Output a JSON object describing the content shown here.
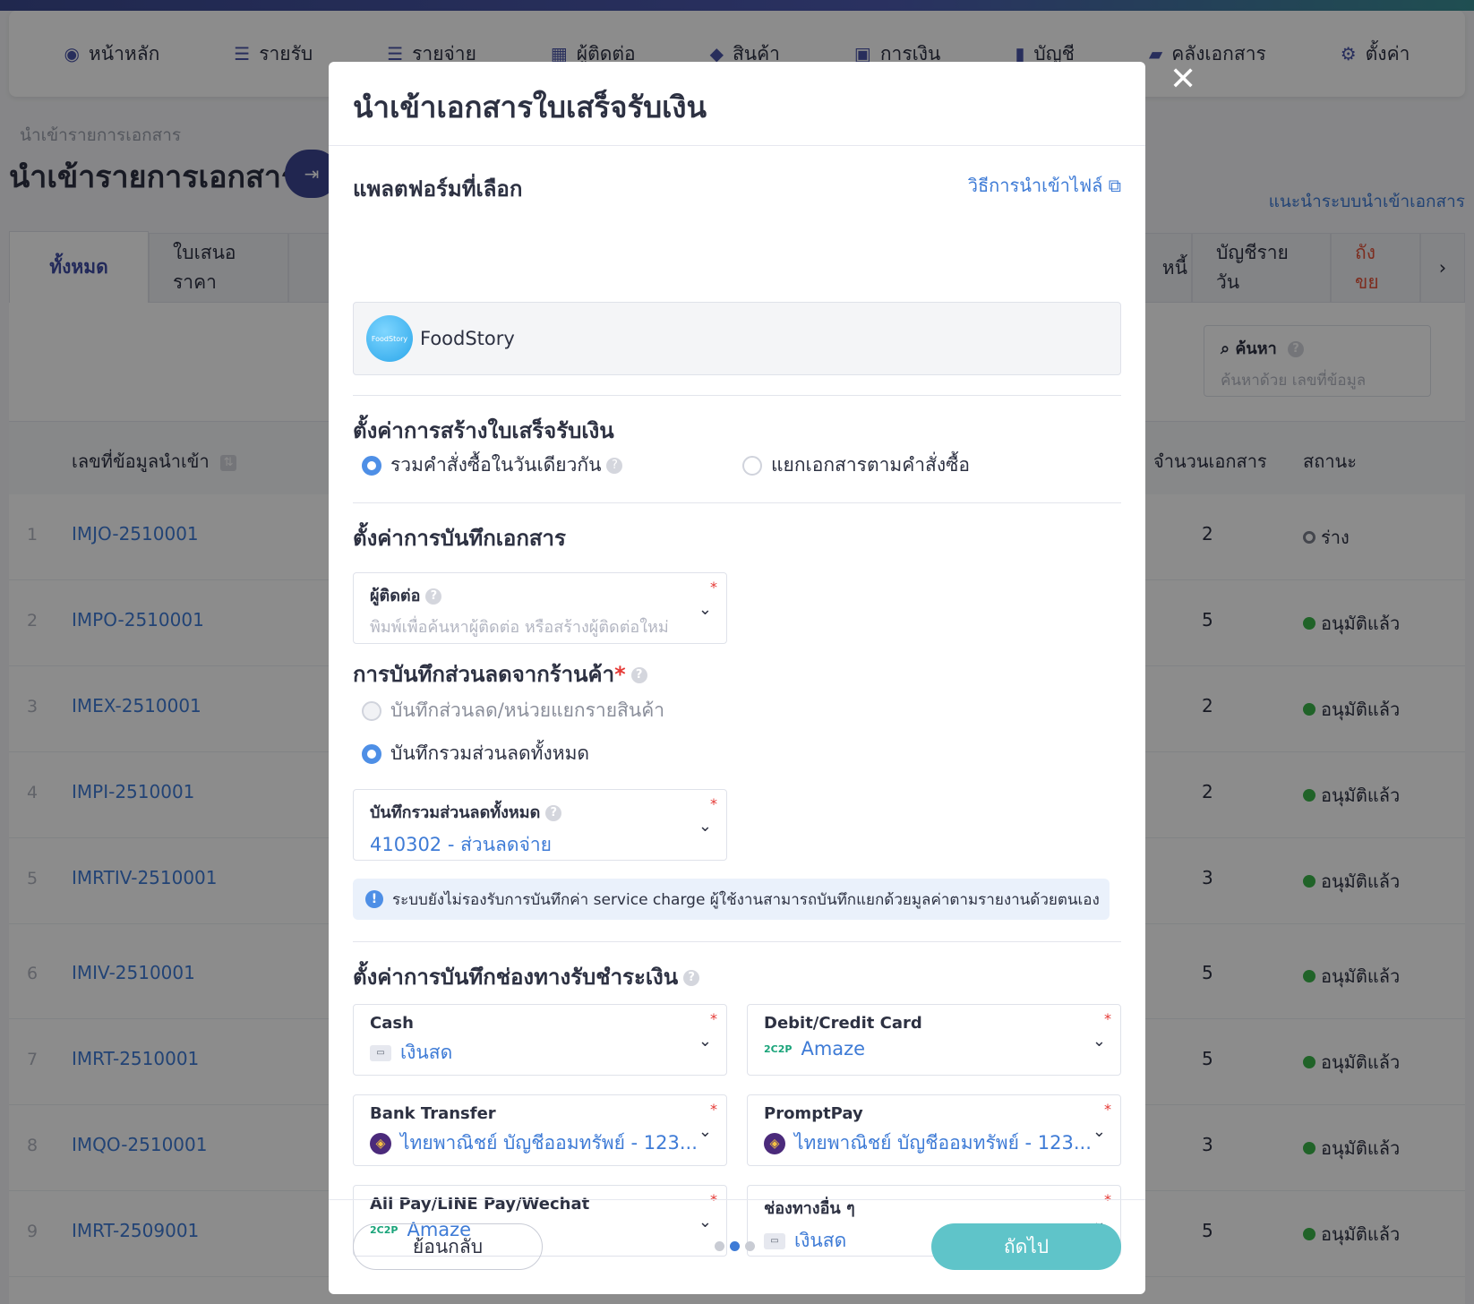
{
  "nav": {
    "items": [
      {
        "label": "หน้าหลัก",
        "icon": "dashboard-icon"
      },
      {
        "label": "รายรับ",
        "icon": "income-icon"
      },
      {
        "label": "รายจ่าย",
        "icon": "expense-icon"
      },
      {
        "label": "ผู้ติดต่อ",
        "icon": "contacts-icon"
      },
      {
        "label": "สินค้า",
        "icon": "product-icon"
      },
      {
        "label": "การเงิน",
        "icon": "finance-icon"
      },
      {
        "label": "บัญชี",
        "icon": "accounting-icon"
      },
      {
        "label": "คลังเอกสาร",
        "icon": "folder-icon"
      },
      {
        "label": "ตั้งค่า",
        "icon": "gear-icon"
      }
    ]
  },
  "page": {
    "breadcrumb": "นำเข้ารายการเอกสาร",
    "title": "นำเข้ารายการเอกสาร",
    "guide_link": "แนะนำระบบนำเข้าเอกสาร"
  },
  "tabs": {
    "all": "ทั้งหมด",
    "quote": "ใบเสนอราคา",
    "debt": "หนี้",
    "daily": "บัญชีรายวัน",
    "overdue": "ถังขย"
  },
  "search": {
    "label": "ค้นหา",
    "placeholder": "ค้นหาด้วย เลขที่ข้อมูล"
  },
  "table": {
    "headers": {
      "code": "เลขที่ข้อมูลนำเข้า",
      "count": "จำนวนเอกสาร",
      "status": "สถานะ"
    },
    "rows": [
      {
        "num": "1",
        "code": "IMJO-2510001",
        "count": "2",
        "status": "ร่าง",
        "approved": false
      },
      {
        "num": "2",
        "code": "IMPO-2510001",
        "count": "5",
        "status": "อนุมัติแล้ว",
        "approved": true
      },
      {
        "num": "3",
        "code": "IMEX-2510001",
        "count": "2",
        "status": "อนุมัติแล้ว",
        "approved": true
      },
      {
        "num": "4",
        "code": "IMPI-2510001",
        "count": "2",
        "status": "อนุมัติแล้ว",
        "approved": true
      },
      {
        "num": "5",
        "code": "IMRTIV-2510001",
        "count": "3",
        "status": "อนุมัติแล้ว",
        "approved": true
      },
      {
        "num": "6",
        "code": "IMIV-2510001",
        "count": "5",
        "status": "อนุมัติแล้ว",
        "approved": true
      },
      {
        "num": "7",
        "code": "IMRT-2510001",
        "count": "5",
        "status": "อนุมัติแล้ว",
        "approved": true
      },
      {
        "num": "8",
        "code": "IMQO-2510001",
        "count": "3",
        "status": "อนุมัติแล้ว",
        "approved": true
      },
      {
        "num": "9",
        "code": "IMRT-2509001",
        "count": "5",
        "status": "อนุมัติแล้ว",
        "approved": true
      }
    ]
  },
  "modal": {
    "title": "นำเข้าเอกสารใบเสร็จรับเงิน",
    "platform_title": "แพลตฟอร์มที่เลือก",
    "import_guide": "วิธีการนำเข้าไฟล์",
    "platform_name": "FoodStory",
    "platform_logo_text": "FoodStory",
    "receipt_title": "ตั้งค่าการสร้างใบเสร็จรับเงิน",
    "receipt_opt1": "รวมคำสั่งซื้อในวันเดียวกัน",
    "receipt_opt2": "แยกเอกสารตามคำสั่งซื้อ",
    "doc_title": "ตั้งค่าการบันทึกเอกสาร",
    "contact_label": "ผู้ติดต่อ",
    "contact_placeholder": "พิมพ์เพื่อค้นหาผู้ติดต่อ หรือสร้างผู้ติดต่อใหม่",
    "discount_title": "การบันทึกส่วนลดจากร้านค้า",
    "discount_opt1": "บันทึกส่วนลด/หน่วยแยกรายสินค้า",
    "discount_opt2": "บันทึกรวมส่วนลดทั้งหมด",
    "discount_field_label": "บันทึกรวมส่วนลดทั้งหมด",
    "discount_field_value": "410302 - ส่วนลดจ่าย",
    "info_text": "ระบบยังไม่รองรับการบันทึกค่า service charge ผู้ใช้งานสามารถบันทึกแยกด้วยมูลค่าตามรายงานด้วยตนเอง",
    "payment_title": "ตั้งค่าการบันทึกช่องทางรับชำระเงิน",
    "payments": {
      "cash_label": "Cash",
      "cash_value": "เงินสด",
      "card_label": "Debit/Credit Card",
      "card_value": "Amaze",
      "transfer_label": "Bank Transfer",
      "transfer_value": "ไทยพาณิชย์ บัญชีออมทรัพย์ - 123...",
      "promptpay_label": "PromptPay",
      "promptpay_value": "ไทยพาณิชย์ บัญชีออมทรัพย์ - 123...",
      "wallet_label": "Ali Pay/LINE Pay/Wechat",
      "wallet_value": "Amaze",
      "other_label": "ช่องทางอื่น ๆ",
      "other_value": "เงินสด"
    },
    "back_label": "ย้อนกลับ",
    "next_label": "ถัดไป",
    "amaze_text": "2C2P"
  }
}
